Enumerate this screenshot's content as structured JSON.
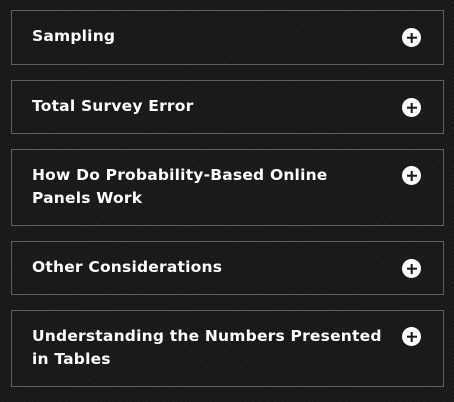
{
  "accordion": {
    "items": [
      {
        "label": "Sampling",
        "icon": "plus-circle-icon"
      },
      {
        "label": "Total Survey Error",
        "icon": "plus-circle-icon"
      },
      {
        "label": "How Do Probability-Based Online Panels Work",
        "icon": "plus-circle-icon"
      },
      {
        "label": "Other Considerations",
        "icon": "plus-circle-icon"
      },
      {
        "label": "Understanding the Numbers Presented in Tables",
        "icon": "plus-circle-icon"
      }
    ]
  },
  "colors": {
    "background": "#1a1a1a",
    "border": "#5f5f5f",
    "text": "#ffffff",
    "icon": "#ffffff"
  }
}
